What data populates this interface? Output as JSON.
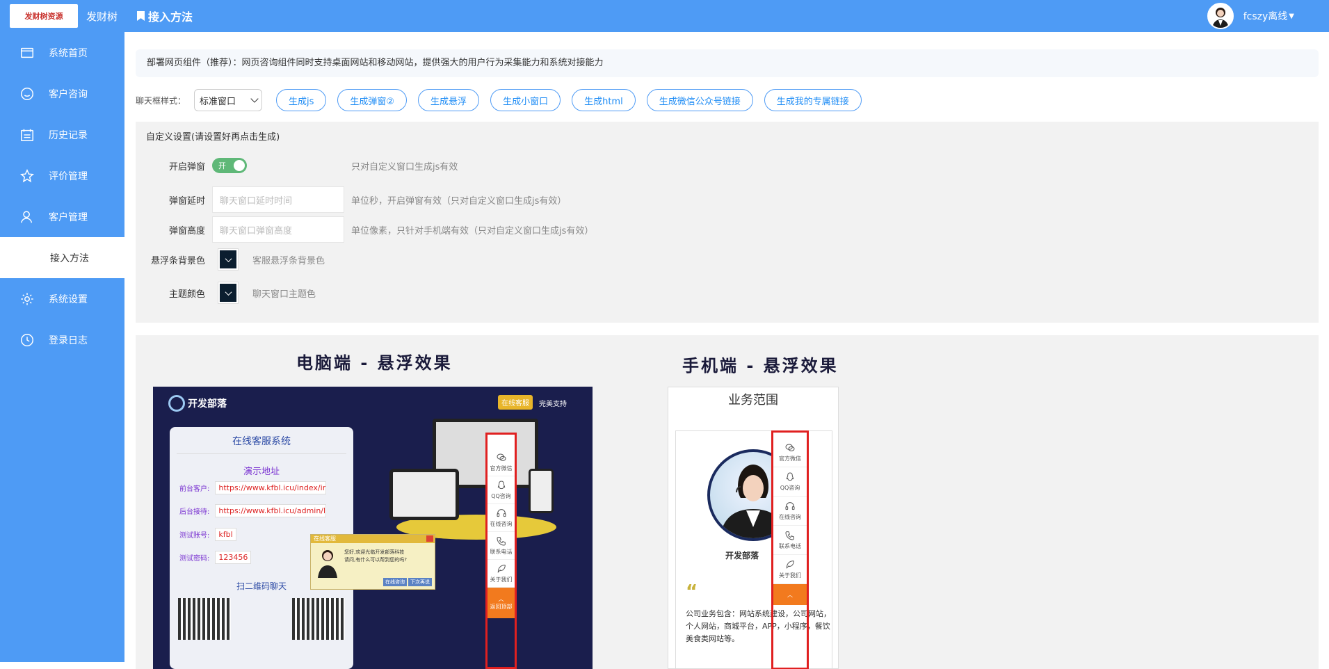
{
  "brand": {
    "logo_text": "发财树资源",
    "name": "发财树"
  },
  "sidebar": {
    "items": [
      {
        "label": "系统首页",
        "icon": "window-icon"
      },
      {
        "label": "客户咨询",
        "icon": "chat-bubble-icon"
      },
      {
        "label": "历史记录",
        "icon": "calendar-list-icon"
      },
      {
        "label": "评价管理",
        "icon": "star-icon"
      },
      {
        "label": "客户管理",
        "icon": "user-icon"
      },
      {
        "label": "接入方法",
        "icon": "",
        "active": true
      },
      {
        "label": "系统设置",
        "icon": "gear-icon"
      },
      {
        "label": "登录日志",
        "icon": "clock-icon"
      }
    ]
  },
  "header": {
    "title": "接入方法",
    "user": "fcszy离线"
  },
  "notice": "部署网页组件（推荐）：网页咨询组件同时支持桌面网站和移动网站，提供强大的用户行为采集能力和系统对接能力",
  "toolbar": {
    "style_label": "聊天框样式：",
    "style_selected": "标准窗口",
    "buttons": [
      "生成js",
      "生成弹窗②",
      "生成悬浮",
      "生成小窗口",
      "生成html",
      "生成微信公众号链接",
      "生成我的专属链接"
    ]
  },
  "settings": {
    "title": "自定义设置(请设置好再点击生成)",
    "popup": {
      "label": "开启弹窗",
      "toggle_text": "开",
      "hint": "只对自定义窗口生成js有效"
    },
    "delay": {
      "label": "弹窗延时",
      "placeholder": "聊天窗口延时时间",
      "hint": "单位秒，开启弹窗有效（只对自定义窗口生成js有效）"
    },
    "height": {
      "label": "弹窗高度",
      "placeholder": "聊天窗口弹窗高度",
      "hint": "单位像素，只针对手机端有效（只对自定义窗口生成js有效）"
    },
    "float_bg": {
      "label": "悬浮条背景色",
      "hint": "客服悬浮条背景色"
    },
    "theme": {
      "label": "主题颜色",
      "hint": "聊天窗口主题色"
    },
    "color": "#0b1e2f"
  },
  "preview": {
    "pc_title": "电脑端 - 悬浮效果",
    "mobile_title": "手机端 - 悬浮效果",
    "pc": {
      "logo": "开发部落",
      "tab_active": "在线客服",
      "tab_other": "完美支持",
      "card_title": "在线客服系统",
      "card_sub": "演示地址",
      "front_label": "前台客户:",
      "front_url": "https://www.kfbl.icu/index/inc",
      "back_label": "后台接待:",
      "back_url": "https://www.kfbl.icu/admin/lc",
      "account_label": "测试账号:",
      "account": "kfbl",
      "password_label": "测试密码:",
      "password": "123456",
      "qr_title": "扫二维码聊天",
      "dialog_title": "在线客服",
      "dialog_text1": "您好,欢迎光临开发部落科技",
      "dialog_text2": "请问,有什么可以帮到您的吗?",
      "dialog_btn1": "在线咨询",
      "dialog_btn2": "下次再说"
    },
    "float_items": [
      "官方微信",
      "QQ咨询",
      "在线咨询",
      "联系电话",
      "关于我们"
    ],
    "float_top": "返回顶部",
    "mobile": {
      "page_title": "业务范围",
      "name": "开发部落",
      "desc": "公司业务包含：网站系统建设，公司网站，个人网站，商城平台，APP，小程序，餐饮美食类网站等。"
    }
  }
}
